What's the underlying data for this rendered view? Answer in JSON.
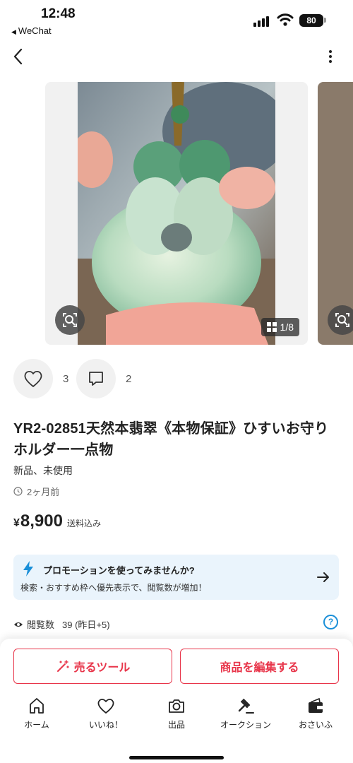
{
  "status_bar": {
    "time": "12:48",
    "back_app": "WeChat",
    "battery": "80"
  },
  "gallery": {
    "counter": "1/8"
  },
  "actions": {
    "likes": "3",
    "comments": "2"
  },
  "item": {
    "title": "YR2-02851天然本翡翠《本物保証》ひすいお守り ホルダー一点物",
    "condition": "新品、未使用",
    "posted": "2ヶ月前",
    "price_symbol": "¥",
    "price": "8,900",
    "shipping": "送料込み"
  },
  "promo": {
    "title": "プロモーションを使ってみませんか?",
    "text": "検索・おすすめ枠へ優先表示で、閲覧数が増加！"
  },
  "stats": {
    "views_label": "閲覧数",
    "views_value": "39 (昨日+5)",
    "help": "?"
  },
  "buttons": {
    "sell_tool": "売るツール",
    "edit_item": "商品を編集する"
  },
  "tabbar": {
    "items": [
      {
        "label": "ホーム",
        "icon": "home-icon"
      },
      {
        "label": "いいね！",
        "icon": "heart-icon"
      },
      {
        "label": "出品",
        "icon": "camera-icon"
      },
      {
        "label": "オークション",
        "icon": "gavel-icon"
      },
      {
        "label": "おさいふ",
        "icon": "wallet-icon"
      }
    ]
  },
  "colors": {
    "accent": "#e8354a",
    "promo_bg": "#eaf4fc",
    "info_blue": "#1a8fd8"
  }
}
